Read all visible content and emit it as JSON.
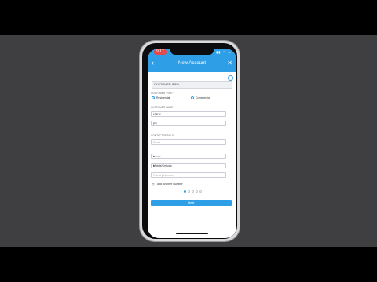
{
  "status_bar": {
    "time": "9:17",
    "icons": "▮▮ ◠ ▭"
  },
  "header": {
    "back_glyph": "‹",
    "title": "New Account",
    "close_glyph": "✕"
  },
  "section": {
    "title": "CUSTOMER INFO"
  },
  "customer_type": {
    "label": "CUSTOMER TYPE *",
    "options": [
      {
        "label": "Residential",
        "selected": true
      },
      {
        "label": "Commercial",
        "selected": false
      }
    ]
  },
  "customer_name": {
    "label": "CUSTOMER NAME",
    "first": "LTEW",
    "last": "PV"
  },
  "contact_details": {
    "label": "CONTACT DETAILS",
    "email_placeholder": "Email",
    "name_placeholder": "Name",
    "phone_type_value": "Mobile/Cellular",
    "phone_placeholder": "Primary Number",
    "add_number_label": "Add Another Number"
  },
  "pager": {
    "count": 5,
    "active_index": 0
  },
  "footer": {
    "next_label": "Next"
  },
  "colors": {
    "accent": "#2e9fe6",
    "time_badge": "#e34b4b",
    "background": "#3f3f41"
  }
}
